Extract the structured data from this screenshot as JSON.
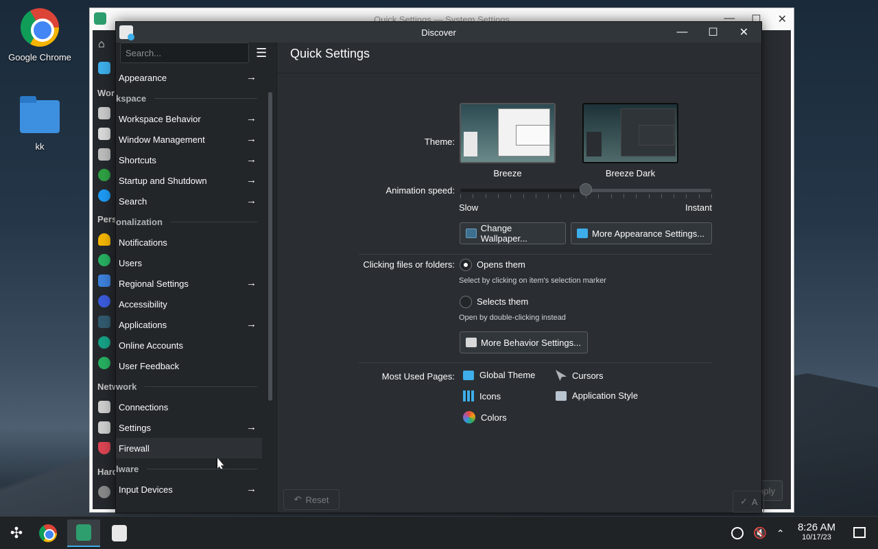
{
  "desktop": {
    "icons": [
      {
        "label": "Google Chrome",
        "icon": "chrome-icon"
      },
      {
        "label": "kk",
        "icon": "folder-icon"
      }
    ]
  },
  "back_window": {
    "title": "Quick Settings — System Settings",
    "sidebar_headers": [
      "Wor",
      "Pers",
      "Netw",
      "Hard"
    ],
    "apply_label": "pply"
  },
  "discover": {
    "title": "Discover",
    "search_placeholder": "Search...",
    "sidebar": {
      "items": [
        {
          "label": "Appearance",
          "arrow": true
        },
        {
          "header": "kspace"
        },
        {
          "label": "Workspace Behavior",
          "arrow": true
        },
        {
          "label": "Window Management",
          "arrow": true
        },
        {
          "label": "Shortcuts",
          "arrow": true
        },
        {
          "label": "Startup and Shutdown",
          "arrow": true
        },
        {
          "label": "Search",
          "arrow": true
        },
        {
          "header": "onalization"
        },
        {
          "label": "Notifications",
          "arrow": false
        },
        {
          "label": "Users",
          "arrow": false
        },
        {
          "label": "Regional Settings",
          "arrow": true
        },
        {
          "label": "Accessibility",
          "arrow": false
        },
        {
          "label": "Applications",
          "arrow": true
        },
        {
          "label": "Online Accounts",
          "arrow": false
        },
        {
          "label": "User Feedback",
          "arrow": false
        },
        {
          "header": "work"
        },
        {
          "label": "Connections",
          "arrow": false
        },
        {
          "label": "Settings",
          "arrow": true
        },
        {
          "label": "Firewall",
          "arrow": false
        },
        {
          "header": "lware"
        },
        {
          "label": "Input Devices",
          "arrow": true
        }
      ]
    },
    "main": {
      "title": "Quick Settings",
      "theme_label": "Theme:",
      "themes": [
        {
          "name": "Breeze",
          "selected": false
        },
        {
          "name": "Breeze Dark",
          "selected": true
        }
      ],
      "animation_label": "Animation speed:",
      "animation_value": 0.5,
      "slow_label": "Slow",
      "instant_label": "Instant",
      "change_wallpaper": "Change Wallpaper...",
      "more_appearance": "More Appearance Settings...",
      "clicking_label": "Clicking files or folders:",
      "opens_them": "Opens them",
      "opens_hint": "Select by clicking on item's selection marker",
      "selects_them": "Selects them",
      "selects_hint": "Open by double-clicking instead",
      "more_behavior": "More Behavior Settings...",
      "most_used_label": "Most Used Pages:",
      "most_used": [
        "Global Theme",
        "Cursors",
        "Icons",
        "Application Style",
        "Colors"
      ],
      "reset_label": "Reset",
      "apply_label": "A"
    }
  },
  "taskbar": {
    "time": "8:26 AM",
    "date": "10/17/23"
  }
}
